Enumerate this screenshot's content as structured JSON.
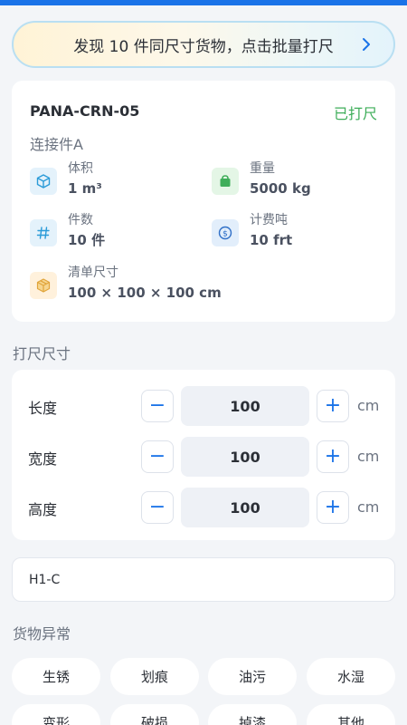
{
  "banner": {
    "text": "发现 10 件同尺寸货物，点击批量打尺"
  },
  "cargo": {
    "code": "PANA-CRN-05",
    "status": "已打尺",
    "status_color": "#3fae5a",
    "name": "连接件A",
    "metrics": [
      {
        "label": "体积",
        "value": "1 m³",
        "icon": "cube-icon"
      },
      {
        "label": "重量",
        "value": "5000 kg",
        "icon": "weight-bag-icon"
      },
      {
        "label": "件数",
        "value": "10 件",
        "icon": "hash-icon"
      },
      {
        "label": "计费吨",
        "value": "10 frt",
        "icon": "dollar-coin-icon"
      },
      {
        "label": "清单尺寸",
        "value": "100 × 100 × 100 cm",
        "icon": "package-icon"
      }
    ]
  },
  "dimensions": {
    "title": "打尺尺寸",
    "rows": [
      {
        "label": "长度",
        "value": "100",
        "unit": "cm"
      },
      {
        "label": "宽度",
        "value": "100",
        "unit": "cm"
      },
      {
        "label": "高度",
        "value": "100",
        "unit": "cm"
      }
    ]
  },
  "location": {
    "value": "H1-C"
  },
  "anomaly": {
    "title": "货物异常",
    "tags": [
      "生锈",
      "划痕",
      "油污",
      "水湿",
      "变形",
      "破损",
      "掉漆",
      "其他"
    ]
  },
  "colors": {
    "accent": "#1a73e8",
    "success": "#3fae5a",
    "background": "#f3f5f8"
  }
}
